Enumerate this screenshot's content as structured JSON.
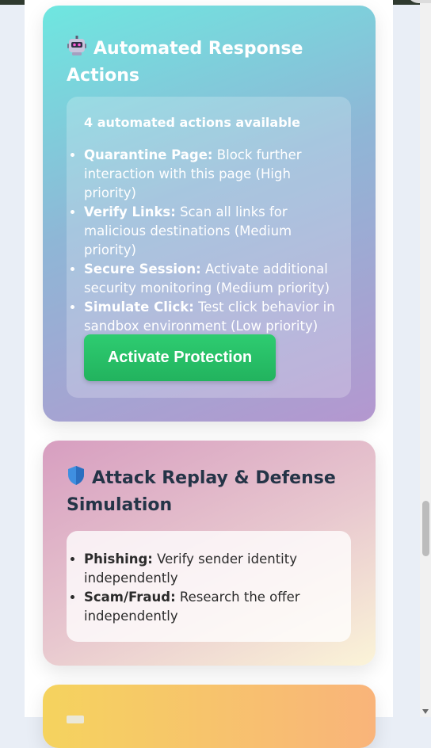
{
  "automated_actions": {
    "title": "Automated Response Actions",
    "summary": "4 automated actions available",
    "items": [
      {
        "label": "Quarantine Page:",
        "text": " Block further interaction with this page (High priority)"
      },
      {
        "label": "Verify Links:",
        "text": " Scan all links for malicious destinations (Medium priority)"
      },
      {
        "label": "Secure Session:",
        "text": " Activate additional security monitoring (Medium priority)"
      },
      {
        "label": "Simulate Click:",
        "text": " Test click behavior in sandbox environment (Low priority)"
      }
    ],
    "button_label": "Activate Protection"
  },
  "attack_replay": {
    "title": "Attack Replay & Defense Simulation",
    "items": [
      {
        "label": "Phishing:",
        "text": " Verify sender identity independently"
      },
      {
        "label": "Scam/Fraud:",
        "text": " Research the offer independently"
      }
    ]
  },
  "icons": {
    "automated_actions": "robot-icon",
    "attack_replay": "shield-icon",
    "next_section": "chart-icon"
  },
  "colors": {
    "button": "#2ecc71",
    "auto_card_start": "#6ee7e0",
    "auto_card_end": "#b497cf",
    "replay_card_start": "#d79ec0",
    "replay_card_end": "#fbf4d8"
  }
}
